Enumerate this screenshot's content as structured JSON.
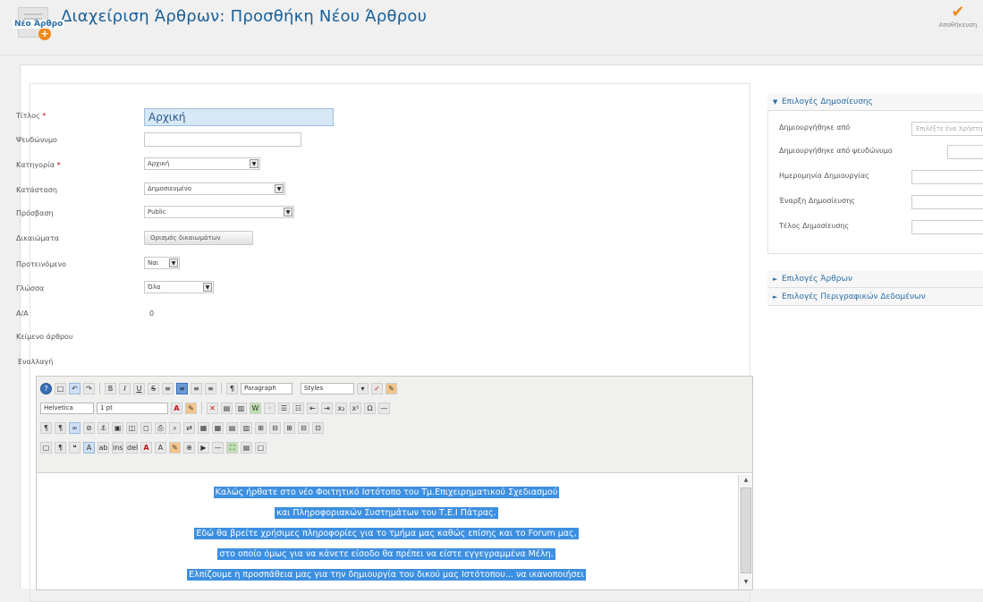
{
  "header": {
    "title": "Διαχείριση Άρθρων: Προσθήκη Νέου Άρθρου",
    "save_label": "Αποθήκευση"
  },
  "form": {
    "legend": "Νέο Άρθρο",
    "fields": {
      "title": {
        "label": "Τίτλος",
        "value": "Αρχική"
      },
      "alias": {
        "label": "Ψευδώνυμο",
        "value": ""
      },
      "category": {
        "label": "Κατηγορία",
        "value": "Αρχική"
      },
      "state": {
        "label": "Κατάσταση",
        "value": "Δημοσιευμένο"
      },
      "access": {
        "label": "Πρόσβαση",
        "value": "Public"
      },
      "permissions": {
        "label": "Δικαιώματα",
        "button": "Ορισμός δικαιωμάτων"
      },
      "featured": {
        "label": "Προτεινόμενο",
        "value": "Nαι"
      },
      "language": {
        "label": "Γλώσσα",
        "value": "Όλα"
      },
      "id": {
        "label": "Α/Α",
        "value": "0"
      },
      "text": {
        "label": "Κείμενο άρθρου"
      }
    },
    "toggle_editor": "Εναλλαγή"
  },
  "editor": {
    "paragraph_select": "Paragraph",
    "styles_select": "Styles",
    "font_select": "Helvetica",
    "size_select": "1 pt",
    "paragraphs": [
      "Καλώς ήρθατε στο νέο Φοιτητικό Ιστότοπο του Τμ.Επιχειρηματικού Σχεδιασμού",
      "και Πληροφοριακών Συστημάτων του Τ.Ε.Ι Πάτρας.",
      "Εδώ θα βρείτε χρήσιμες πληροφορίες για το τμήμα μας καθώς επίσης και το Forum μας,",
      "στο οποίο όμως για να κάνετε είσοδο θα πρέπει να είστε εγγεγραμμένα Μέλη.",
      "Ελπίζουμε η προσπάθεια μας για την δημιουργία του δικού μας Ιστότοπου... να ικανοποιήσει"
    ]
  },
  "side": {
    "publishing": {
      "heading": "Επιλογές Δημοσίευσης",
      "rows": [
        {
          "label": "Δημιουργήθηκε από",
          "value": "Επιλέξτε ένα Χρήστη"
        },
        {
          "label": "Δημιουργήθηκε από ψευδώνυμο",
          "value": ""
        },
        {
          "label": "Ημερομηνία Δημιουργίας",
          "value": ""
        },
        {
          "label": "Έναρξη Δημοσίευσης",
          "value": ""
        },
        {
          "label": "Τέλος Δημοσίευσης",
          "value": ""
        }
      ]
    },
    "article_options": "Επιλογές Άρθρων",
    "metadata_options": "Επιλογές Περιγραφικών Δεδομένων"
  }
}
